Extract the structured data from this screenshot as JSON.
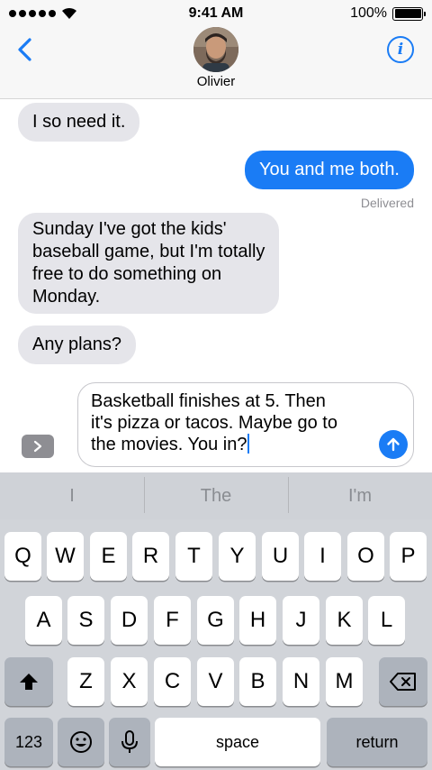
{
  "status_bar": {
    "time": "9:41 AM",
    "battery": "100%",
    "battery_level": 1.0
  },
  "header": {
    "contact_name": "Olivier"
  },
  "conversation": {
    "messages": [
      {
        "direction": "incoming",
        "text": "I so need it."
      },
      {
        "direction": "outgoing",
        "text": "You and me both."
      },
      {
        "direction": "incoming",
        "lines": [
          "Sunday I've got the kids'",
          "baseball game, but I'm totally",
          "free to do something on",
          "Monday."
        ]
      },
      {
        "direction": "incoming",
        "text": "Any plans?"
      }
    ],
    "delivered_label": "Delivered"
  },
  "compose": {
    "lines": [
      "Basketball finishes at 5. Then",
      "it's pizza or tacos. Maybe go to",
      "the movies. You in?"
    ]
  },
  "keyboard": {
    "suggestions": [
      "I",
      "The",
      "I'm"
    ],
    "row1": [
      "Q",
      "W",
      "E",
      "R",
      "T",
      "Y",
      "U",
      "I",
      "O",
      "P"
    ],
    "row2": [
      "A",
      "S",
      "D",
      "F",
      "G",
      "H",
      "J",
      "K",
      "L"
    ],
    "row3": [
      "Z",
      "X",
      "C",
      "V",
      "B",
      "N",
      "M"
    ],
    "numbers_key": "123",
    "space_key": "space",
    "return_key": "return"
  },
  "colors": {
    "accent": "#1a7cf5",
    "incoming_bubble": "#e5e5ea",
    "keyboard_bg": "#d1d4d9"
  },
  "icons": [
    "signal-dots-icon",
    "wifi-icon",
    "battery-icon",
    "back-chevron-icon",
    "info-icon",
    "expand-chevron-icon",
    "send-arrow-icon",
    "shift-icon",
    "delete-icon",
    "emoji-icon",
    "microphone-icon"
  ]
}
